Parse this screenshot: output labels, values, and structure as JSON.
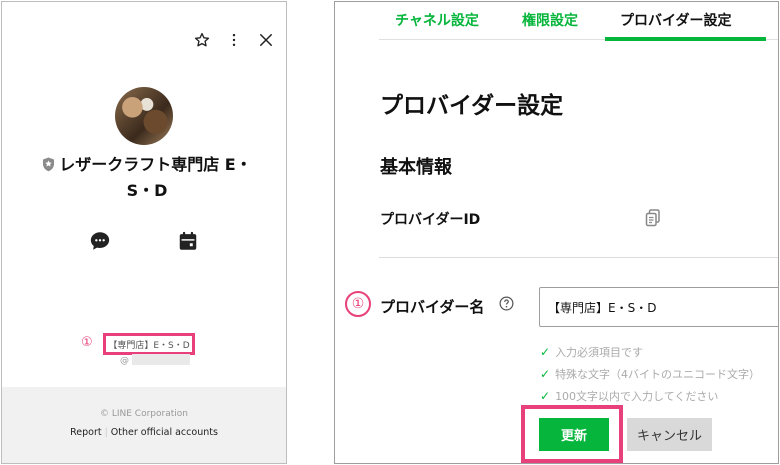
{
  "profile": {
    "shop_name": "レザークラフト専門店 E・S・D",
    "marker": "①",
    "provider_display": "【専門店】E・S・D",
    "at_prefix": "@",
    "footer": {
      "copyright": "© LINE Corporation",
      "report": "Report",
      "separator": "|",
      "other_accounts": "Other official accounts"
    },
    "icons": [
      "star-icon",
      "more-vert-icon",
      "close-icon",
      "chat-icon",
      "calendar-icon",
      "shield-icon"
    ]
  },
  "settings": {
    "tabs": [
      {
        "label": "チャネル設定"
      },
      {
        "label": "権限設定"
      },
      {
        "label": "プロバイダー設定"
      }
    ],
    "page_title": "プロバイダー設定",
    "section_title": "基本情報",
    "provider_id_label": "プロバイダーID",
    "marker": "①",
    "provider_name_label": "プロバイダー名",
    "provider_name_value": "【専門店】E・S・D",
    "rules": [
      "入力必須項目です",
      "特殊な文字（4バイトのユニコード文字）",
      "100文字以内で入力してください"
    ],
    "update_label": "更新",
    "cancel_label": "キャンセル"
  },
  "colors": {
    "line_green": "#06b53c",
    "highlight_pink": "#e8407a"
  }
}
